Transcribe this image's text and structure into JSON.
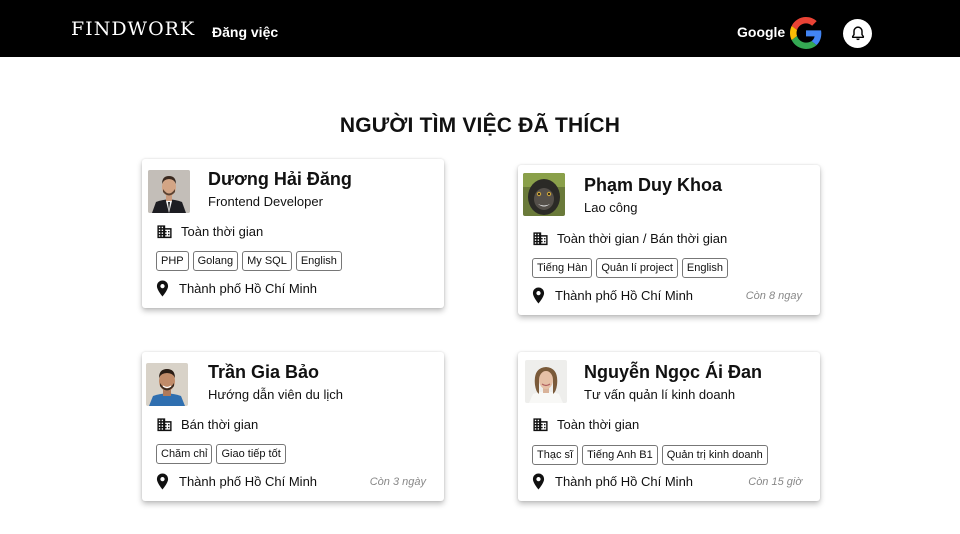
{
  "nav": {
    "logo": "FINDWORK",
    "post_job": "Đăng việc",
    "login_label": "Google"
  },
  "page": {
    "title": "NGƯỜI TÌM VIỆC ĐÃ THÍCH"
  },
  "candidates": [
    {
      "name": "Dương Hải Đăng",
      "role": "Frontend Developer",
      "work_type": "Toàn thời gian",
      "skills": [
        "PHP",
        "Golang",
        "My SQL",
        "English"
      ],
      "location": "Thành phố Hồ Chí Minh",
      "time_left": ""
    },
    {
      "name": "Phạm Duy Khoa",
      "role": "Lao công",
      "work_type": "Toàn thời gian / Bán thời gian",
      "skills": [
        "Tiếng Hàn",
        "Quản lí project",
        "English"
      ],
      "location": "Thành phố Hồ Chí Minh",
      "time_left": "Còn 8 ngay"
    },
    {
      "name": "Trần Gia Bảo",
      "role": "Hướng dẫn viên du lịch",
      "work_type": "Bán thời gian",
      "skills": [
        "Chăm chỉ",
        "Giao tiếp tốt"
      ],
      "location": "Thành phố Hồ Chí Minh",
      "time_left": "Còn 3 ngày"
    },
    {
      "name": "Nguyễn Ngọc Ái Đan",
      "role": "Tư vấn quản lí kinh doanh",
      "work_type": "Toàn thời gian",
      "skills": [
        "Thạc sĩ",
        "Tiếng Anh B1",
        "Quản trị kinh doanh"
      ],
      "location": "Thành phố Hồ Chí Minh",
      "time_left": "Còn 15 giờ"
    }
  ],
  "colors": {
    "navbar_bg": "#000000",
    "page_bg": "#ffffff",
    "google_blue": "#4285F4",
    "google_red": "#EA4335",
    "google_yellow": "#FBBC05",
    "google_green": "#34A853"
  },
  "icons": {
    "work_type": "building-icon",
    "location": "map-pin-icon",
    "notifications": "bell-icon",
    "login": "google-icon"
  }
}
